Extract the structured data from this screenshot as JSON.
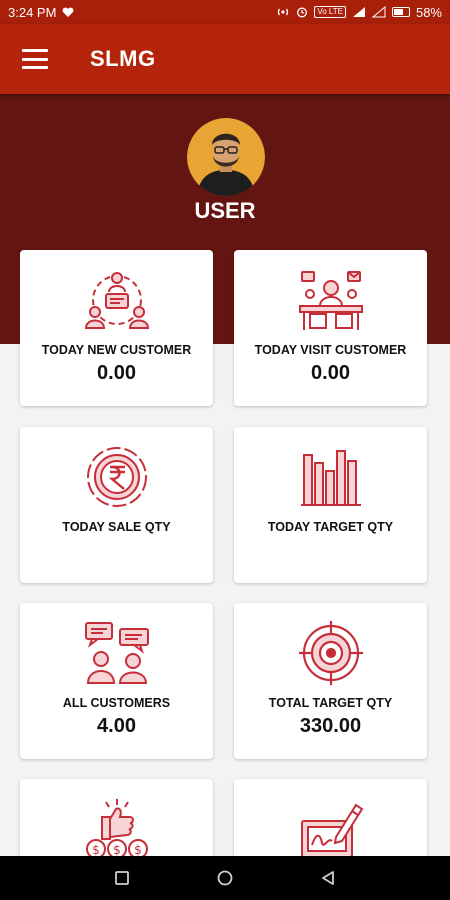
{
  "status_bar": {
    "time": "3:24 PM",
    "network": "Vo LTE",
    "battery": "58%"
  },
  "app_bar": {
    "title": "SLMG"
  },
  "profile": {
    "name": "USER"
  },
  "cards": [
    {
      "label": "TODAY NEW CUSTOMER",
      "value": "0.00",
      "icon": "customer-network-icon"
    },
    {
      "label": "TODAY VISIT CUSTOMER",
      "value": "0.00",
      "icon": "visit-desk-icon"
    },
    {
      "label": "TODAY SALE QTY",
      "value": "",
      "icon": "rupee-coin-icon"
    },
    {
      "label": "TODAY TARGET QTY",
      "value": "",
      "icon": "bar-chart-icon"
    },
    {
      "label": "ALL CUSTOMERS",
      "value": "4.00",
      "icon": "customers-chat-icon"
    },
    {
      "label": "TOTAL TARGET QTY",
      "value": "330.00",
      "icon": "target-icon"
    },
    {
      "label": "",
      "value": "",
      "icon": "thumbs-up-money-icon"
    },
    {
      "label": "",
      "value": "",
      "icon": "sign-document-icon"
    }
  ],
  "colors": {
    "accent": "#b4240b",
    "hero": "#631512",
    "icon": "#c62f3a"
  }
}
